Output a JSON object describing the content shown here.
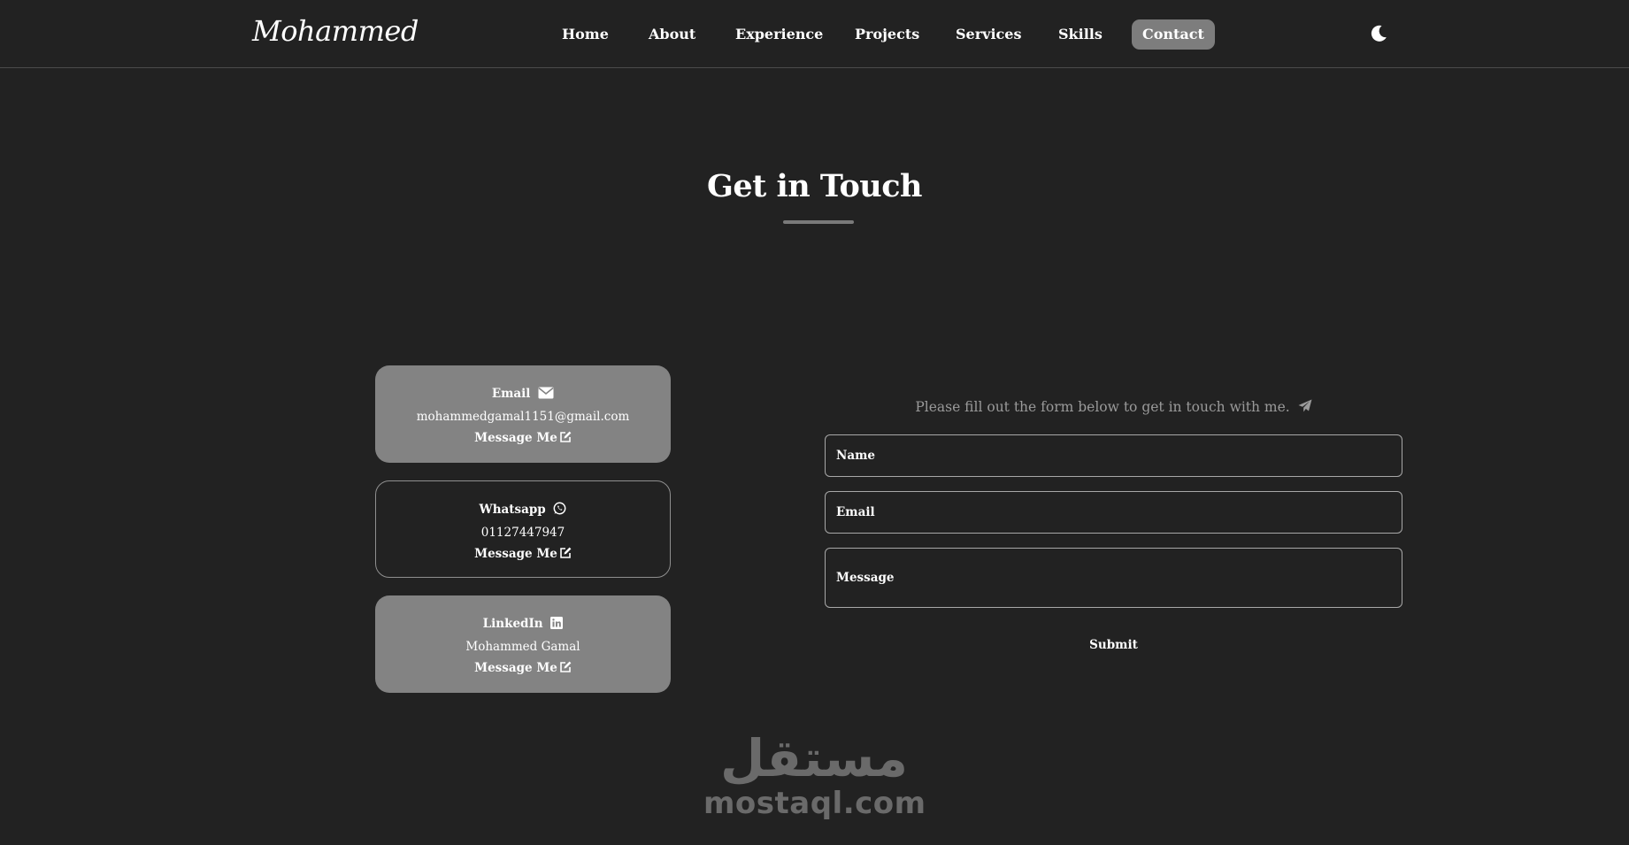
{
  "navbar": {
    "logo": "Mohammed",
    "links": [
      {
        "label": "Home"
      },
      {
        "label": "About"
      },
      {
        "label": "Experience"
      },
      {
        "label": "Projects"
      },
      {
        "label": "Services"
      },
      {
        "label": "Skills"
      },
      {
        "label": "Contact",
        "active": true
      }
    ],
    "theme_toggle_icon": "moon-icon"
  },
  "section": {
    "title": "Get in Touch"
  },
  "contact_cards": [
    {
      "label": "Email",
      "icon": "envelope-icon",
      "value": "mohammedgamal1151@gmail.com",
      "link_label": "Message Me",
      "link_icon": "edit-icon",
      "style": "filled"
    },
    {
      "label": "Whatsapp",
      "icon": "whatsapp-icon",
      "value": "01127447947",
      "link_label": "Message Me",
      "link_icon": "edit-icon",
      "style": "outlined"
    },
    {
      "label": "LinkedIn",
      "icon": "linkedin-icon",
      "value": "Mohammed Gamal",
      "link_label": "Message Me",
      "link_icon": "edit-icon",
      "style": "filled"
    }
  ],
  "form": {
    "intro": "Please fill out the form below to get in touch with me.",
    "intro_icon": "paper-plane-icon",
    "name_placeholder": "Name",
    "email_placeholder": "Email",
    "message_placeholder": "Message",
    "submit_label": "Submit"
  },
  "watermark": {
    "arabic": "مستقل",
    "latin": "mostaql.com"
  },
  "colors": {
    "background": "#222222",
    "card_fill": "#838383",
    "active_nav": "#7d7d7d",
    "muted_text": "#9a9a9a"
  }
}
